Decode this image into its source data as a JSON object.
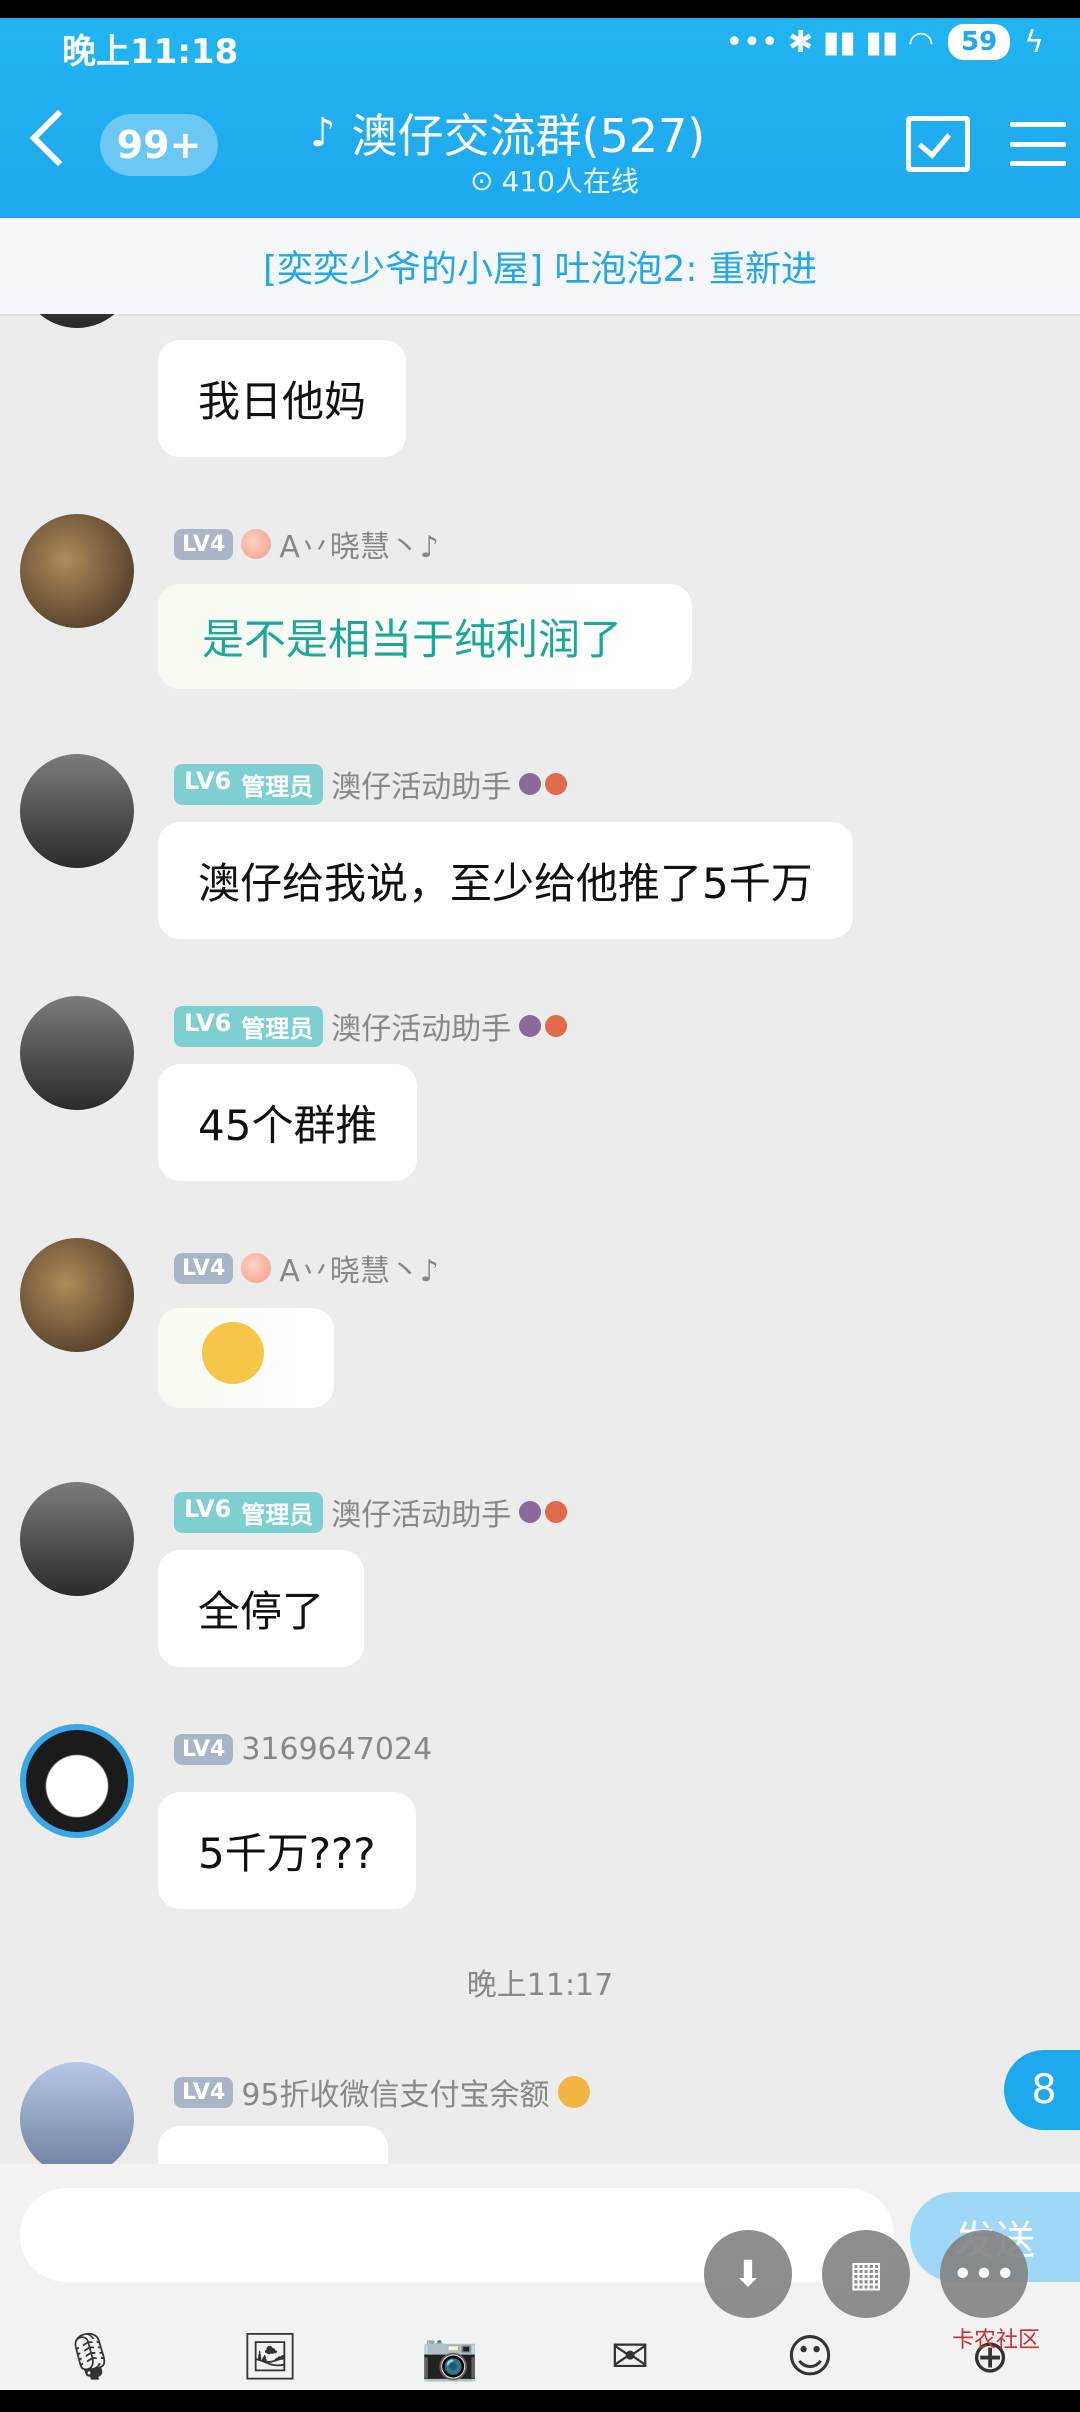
{
  "status": {
    "time": "晚上11:18",
    "battery": "59",
    "icons": "signal-wifi-icons"
  },
  "header": {
    "unread": "99+",
    "title": "澳仔交流群(527)",
    "online": "410人在线"
  },
  "announcement": "[奕奕少爷的小屋] 吐泡泡2: 重新进",
  "messages": [
    {
      "level": "",
      "name": "",
      "text": "我日他妈"
    },
    {
      "level": "LV4",
      "name": "A丷晓慧丶♪",
      "text": "是不是相当于纯利润了"
    },
    {
      "level": "LV6",
      "role": "管理员",
      "name": "澳仔活动助手",
      "text": "澳仔给我说，至少给他推了5千万"
    },
    {
      "level": "LV6",
      "role": "管理员",
      "name": "澳仔活动助手",
      "text": "45个群推"
    },
    {
      "level": "LV4",
      "name": "A丷晓慧丶♪",
      "text": ""
    },
    {
      "level": "LV6",
      "role": "管理员",
      "name": "澳仔活动助手",
      "text": "全停了"
    },
    {
      "level": "LV4",
      "name": "3169647024",
      "text": "5千万???"
    },
    {
      "level": "LV4",
      "name": "95折收微信支付宝余额",
      "text": ""
    }
  ],
  "timestamp": "晚上11:17",
  "new_count": "8",
  "input": {
    "send": "发送"
  },
  "watermark": "卡农社区"
}
